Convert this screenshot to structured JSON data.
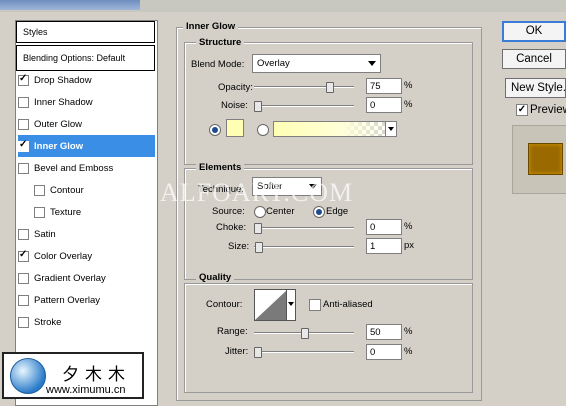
{
  "left_panel": {
    "header": "Styles",
    "blending": "Blending Options: Default",
    "items": [
      {
        "label": "Drop Shadow",
        "checked": true,
        "active": false,
        "sub": false
      },
      {
        "label": "Inner Shadow",
        "checked": false,
        "active": false,
        "sub": false
      },
      {
        "label": "Outer Glow",
        "checked": false,
        "active": false,
        "sub": false
      },
      {
        "label": "Inner Glow",
        "checked": true,
        "active": true,
        "sub": false
      },
      {
        "label": "Bevel and Emboss",
        "checked": false,
        "active": false,
        "sub": false
      },
      {
        "label": "Contour",
        "checked": false,
        "active": false,
        "sub": true
      },
      {
        "label": "Texture",
        "checked": false,
        "active": false,
        "sub": true
      },
      {
        "label": "Satin",
        "checked": false,
        "active": false,
        "sub": false
      },
      {
        "label": "Color Overlay",
        "checked": true,
        "active": false,
        "sub": false
      },
      {
        "label": "Gradient Overlay",
        "checked": false,
        "active": false,
        "sub": false
      },
      {
        "label": "Pattern Overlay",
        "checked": false,
        "active": false,
        "sub": false
      },
      {
        "label": "Stroke",
        "checked": false,
        "active": false,
        "sub": false
      }
    ]
  },
  "inner_glow": {
    "title": "Inner Glow",
    "structure": {
      "title": "Structure",
      "blend_mode_label": "Blend Mode:",
      "blend_mode_value": "Overlay",
      "opacity_label": "Opacity:",
      "opacity_value": "75",
      "noise_label": "Noise:",
      "noise_value": "0",
      "percent": "%",
      "color": "#ffffb4"
    },
    "elements": {
      "title": "Elements",
      "technique_label": "Technique:",
      "technique_value": "Softer",
      "source_label": "Source:",
      "source_center": "Center",
      "source_edge": "Edge",
      "source_selected": "Edge",
      "choke_label": "Choke:",
      "choke_value": "0",
      "size_label": "Size:",
      "size_value": "1",
      "px": "px",
      "percent": "%"
    },
    "quality": {
      "title": "Quality",
      "contour_label": "Contour:",
      "antialiased_label": "Anti-aliased",
      "range_label": "Range:",
      "range_value": "50",
      "jitter_label": "Jitter:",
      "jitter_value": "0",
      "percent": "%"
    }
  },
  "buttons": {
    "ok": "OK",
    "cancel": "Cancel",
    "new_style": "New Style...",
    "preview": "Preview"
  },
  "watermark": "ALFOART.COM",
  "logo": {
    "chinese": "夕木木",
    "url": "www.ximumu.cn"
  },
  "colors": {
    "active_row": "#3a8ee6",
    "preview_swatch": "#9a6a00"
  }
}
